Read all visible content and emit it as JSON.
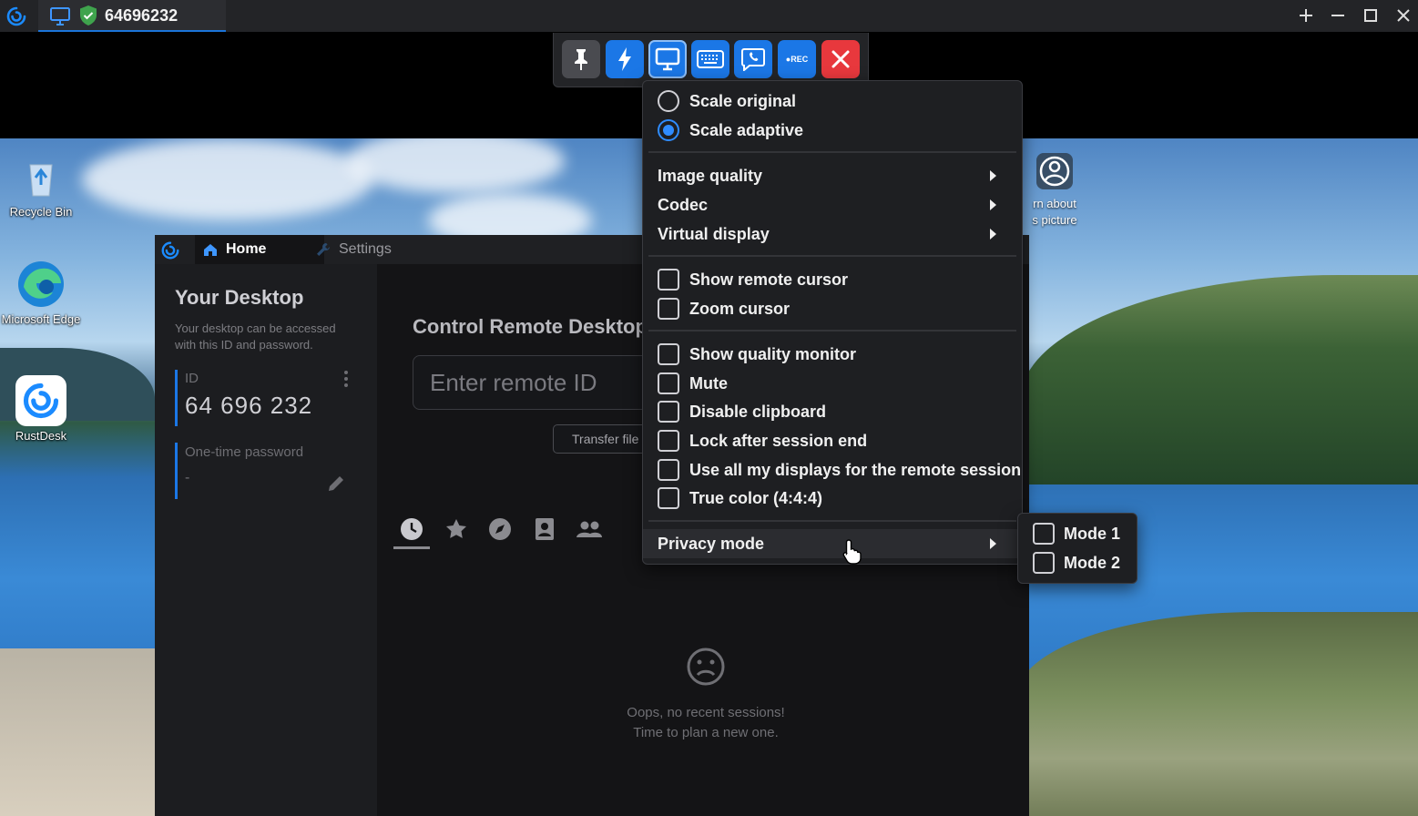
{
  "titlebar": {
    "session_id": "64696232",
    "controls": {
      "add": "+",
      "minimize": "—",
      "maximize": "☐",
      "close": "✕"
    }
  },
  "toolbar": {
    "buttons": [
      {
        "icon": "pin-icon"
      },
      {
        "icon": "lightning-icon"
      },
      {
        "icon": "monitor-icon",
        "active": true
      },
      {
        "icon": "keyboard-icon"
      },
      {
        "icon": "phone-chat-icon"
      },
      {
        "icon": "record-icon",
        "label": "●REC"
      },
      {
        "icon": "close-icon"
      }
    ]
  },
  "desktop": {
    "icons": [
      {
        "label": "Recycle Bin",
        "icon": "recycle-bin-icon"
      },
      {
        "label": "Microsoft Edge",
        "icon": "edge-icon"
      },
      {
        "label": "RustDesk",
        "icon": "rustdesk-icon"
      }
    ],
    "about_picture_label": "rn about\ns picture"
  },
  "app": {
    "tabs": {
      "home": "Home",
      "settings": "Settings"
    },
    "your_desktop": {
      "title": "Your Desktop",
      "description": "Your desktop can be accessed with this ID and password.",
      "id_label": "ID",
      "id_value": "64 696 232",
      "password_label": "One-time password",
      "password_value": "-"
    },
    "control": {
      "title": "Control Remote Desktop",
      "remote_id_placeholder": "Enter remote ID",
      "transfer_button": "Transfer file"
    },
    "recent": {
      "empty_line1": "Oops, no recent sessions!",
      "empty_line2": "Time to plan a new one."
    }
  },
  "menu": {
    "scale_original": "Scale original",
    "scale_adaptive": "Scale adaptive",
    "selected_scale": "adaptive",
    "image_quality": "Image quality",
    "codec": "Codec",
    "virtual_display": "Virtual display",
    "show_remote_cursor": "Show remote cursor",
    "zoom_cursor": "Zoom cursor",
    "show_quality_monitor": "Show quality monitor",
    "mute": "Mute",
    "disable_clipboard": "Disable clipboard",
    "lock_after_session_end": "Lock after session end",
    "use_all_displays": "Use all my displays for the remote session",
    "true_color": "True color (4:4:4)",
    "privacy_mode": "Privacy mode"
  },
  "privacy_submenu": {
    "mode1": "Mode 1",
    "mode2": "Mode 2"
  },
  "colors": {
    "accent": "#1b77e6",
    "danger": "#e8383d",
    "menu_bg": "#1e1f22"
  }
}
